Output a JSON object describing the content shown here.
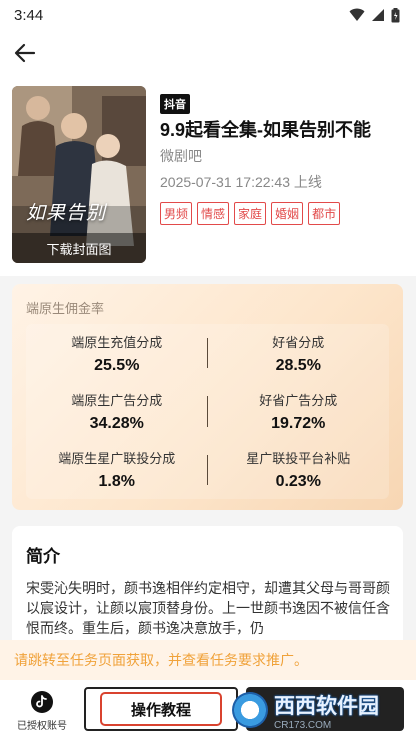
{
  "status_bar": {
    "time": "3:44"
  },
  "drama": {
    "platform_badge": "抖音",
    "title": "9.9起看全集-如果告别不能",
    "source": "微剧吧",
    "release": "2025-07-31 17:22:43 上线",
    "tags": [
      "男频",
      "情感",
      "家庭",
      "婚姻",
      "都市"
    ],
    "poster": {
      "title_art": "如果告别",
      "caption": "下载封面图"
    }
  },
  "commission": {
    "heading": "端原生佣金率",
    "rates": [
      {
        "label": "端原生充值分成",
        "value": "25.5%"
      },
      {
        "label": "好省分成",
        "value": "28.5%"
      },
      {
        "label": "端原生广告分成",
        "value": "34.28%"
      },
      {
        "label": "好省广告分成",
        "value": "19.72%"
      },
      {
        "label": "端原生星广联投分成",
        "value": "1.8%"
      },
      {
        "label": "星广联投平台补贴",
        "value": "0.23%"
      }
    ]
  },
  "intro": {
    "heading": "简介",
    "text": "宋雯沁失明时，颜书逸相伴约定相守，却遭其父母与哥哥颜以宸设计，让颜以宸顶替身份。上一世颜书逸因不被信任含恨而终。重生后，颜书逸决意放手，仍"
  },
  "notice": "请跳转至任务页面获取，并查看任务要求推广。",
  "bottom_bar": {
    "account_label": "已授权账号",
    "tutorial_label": "操作教程"
  },
  "watermark": {
    "brand": "西西软件园",
    "domain": "CR173.COM"
  },
  "colors": {
    "accent_red": "#e24a4a",
    "notice_orange": "#f0a23a"
  }
}
